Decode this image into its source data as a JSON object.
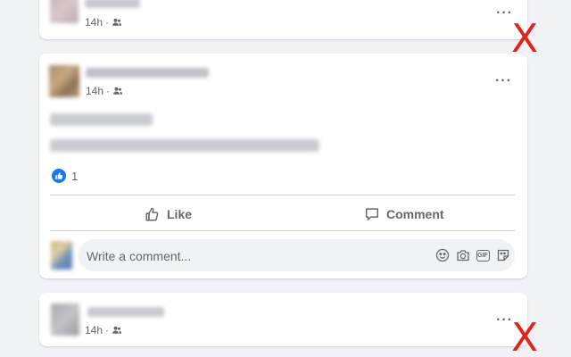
{
  "posts": [
    {
      "timestamp": "14h"
    },
    {
      "timestamp": "14h",
      "reaction_count": "1",
      "actions": {
        "like": "Like",
        "comment": "Comment"
      },
      "comment_placeholder": "Write a comment..."
    },
    {
      "timestamp": "14h"
    }
  ],
  "annotation": {
    "mark": "X",
    "color": "#e0241b"
  },
  "icons": {
    "audience": "friends-icon",
    "menu": "more-options-icon",
    "like": "thumbs-up-icon",
    "comment": "speech-bubble-icon",
    "emoji": "emoji-icon",
    "camera": "camera-icon",
    "gif": "gif-icon",
    "sticker": "sticker-icon"
  },
  "colors": {
    "brand": "#1877f2",
    "background": "#f0f2f5",
    "muted": "#65676b"
  }
}
